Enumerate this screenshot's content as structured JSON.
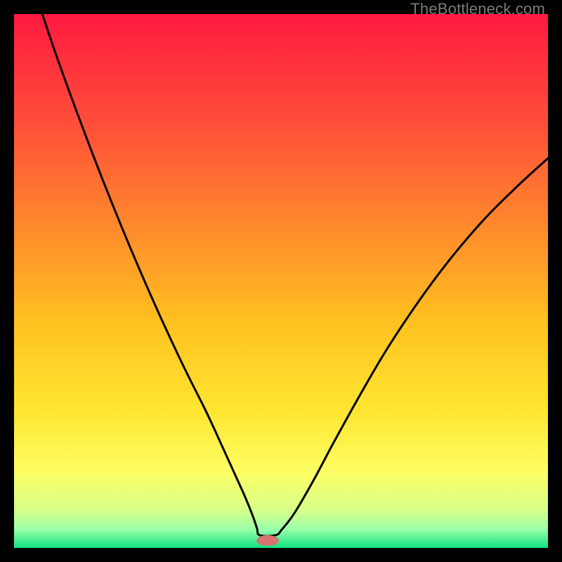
{
  "watermark": "TheBottleneck.com",
  "chart_data": {
    "type": "line",
    "title": "",
    "xlabel": "",
    "ylabel": "",
    "xlim": [
      0,
      100
    ],
    "ylim": [
      0,
      100
    ],
    "background_gradient": {
      "stops": [
        {
          "offset": 0.0,
          "color": "#ff1a3f"
        },
        {
          "offset": 0.2,
          "color": "#ff4d3a"
        },
        {
          "offset": 0.4,
          "color": "#ff8a2c"
        },
        {
          "offset": 0.58,
          "color": "#ffc21f"
        },
        {
          "offset": 0.75,
          "color": "#ffe732"
        },
        {
          "offset": 0.86,
          "color": "#fdff66"
        },
        {
          "offset": 0.93,
          "color": "#d6ff8a"
        },
        {
          "offset": 0.965,
          "color": "#9bffaa"
        },
        {
          "offset": 1.0,
          "color": "#0fe27f"
        }
      ]
    },
    "series": [
      {
        "name": "bottleneck-curve",
        "color": "#000000",
        "x": [
          5.3,
          8,
          12,
          16,
          20,
          24,
          28,
          32,
          36,
          39,
          41.5,
          43.3,
          44.6,
          45.5,
          46.0,
          49.0,
          50.2,
          52.5,
          56,
          60,
          65,
          70,
          76,
          82,
          88,
          94,
          100
        ],
        "y": [
          100,
          92,
          81,
          70.5,
          60.5,
          51,
          42,
          33.5,
          25.5,
          19,
          13.5,
          9.5,
          6.3,
          3.7,
          2.4,
          2.4,
          3.5,
          6.5,
          12.5,
          20,
          29,
          37.5,
          46.5,
          54.5,
          61.5,
          67.5,
          73
        ]
      }
    ],
    "marker": {
      "name": "bottleneck-minimum",
      "x": 47.5,
      "y": 1.4,
      "rx": 2.1,
      "ry": 1.0,
      "color": "#d8736f"
    }
  }
}
